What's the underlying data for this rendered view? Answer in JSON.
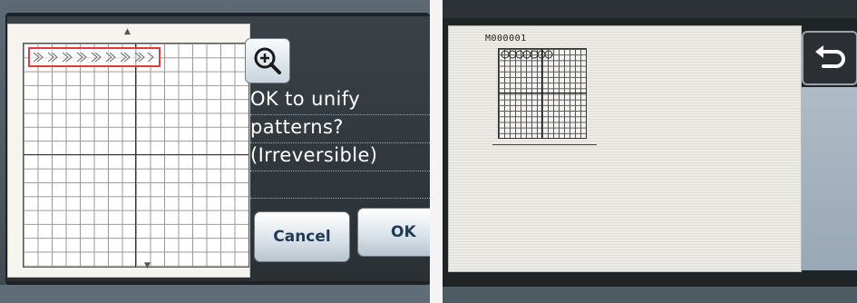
{
  "left_screen": {
    "dialog": {
      "message_lines": [
        "OK to unify",
        "patterns?",
        "(Irreversible)",
        ""
      ],
      "cancel_label": "Cancel",
      "ok_label": "OK"
    },
    "zoom_icon": "zoom-in-icon",
    "arrow_up": "▲",
    "arrow_down": "▼",
    "pattern_highlight_color": "#e23b3b"
  },
  "right_screen": {
    "design_id": "M000001",
    "back_icon": "undo-arrow-icon"
  },
  "colors": {
    "button_text": "#1f3b57",
    "screen_text": "#ffffff"
  }
}
